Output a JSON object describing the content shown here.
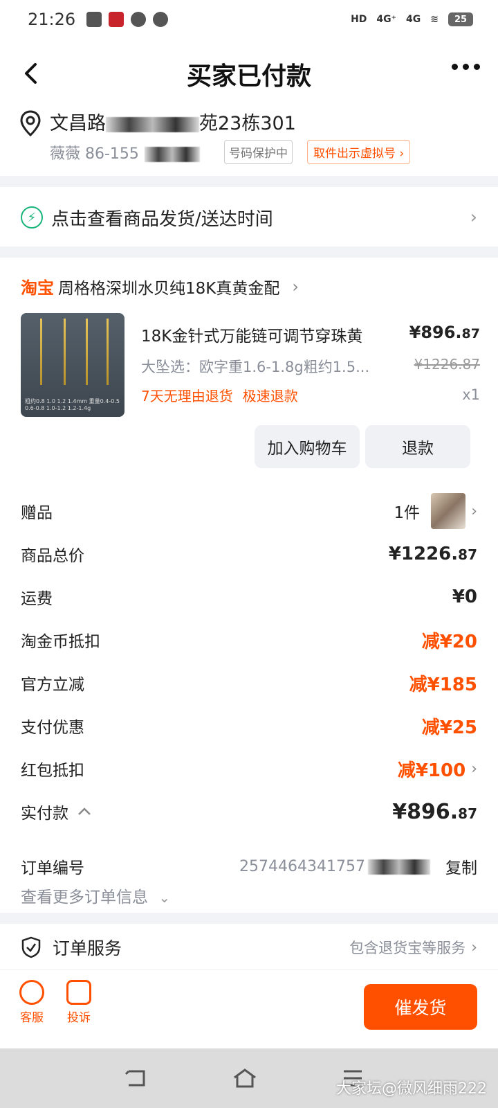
{
  "status": {
    "time": "21:26",
    "battery": "25",
    "network1": "4G⁺",
    "network2": "4G"
  },
  "nav": {
    "title": "买家已付款"
  },
  "address": {
    "line_prefix": "文昌路",
    "line_suffix": "苑23栋301",
    "contact": "薇薇 86-155",
    "protect_tag": "号码保护中",
    "virtual_tag": "取件出示虚拟号 ›"
  },
  "delivery": {
    "text": "点击查看商品发货/送达时间"
  },
  "shop": {
    "logo": "淘宝",
    "name": "周格格深圳水贝纯18K真黄金配"
  },
  "product": {
    "title": "18K金针式万能链可调节穿珠黄",
    "price_main": "¥896.",
    "price_cents": "87",
    "spec": "大坠选：欧字重1.6-1.8g粗约1.5...",
    "original_price": "¥1226.87",
    "promo1": "7天无理由退货",
    "promo2": "极速退款",
    "qty": "x1",
    "img_caption": "粗约0.8 1.0 1.2 1.4mm 重量0.4-0.5 0.6-0.8 1.0-1.2 1.2-1.4g"
  },
  "buttons": {
    "cart": "加入购物车",
    "refund": "退款"
  },
  "fees": {
    "gift_label": "赠品",
    "gift_count": "1件",
    "total_label": "商品总价",
    "total_main": "¥1226.",
    "total_cents": "87",
    "shipping_label": "运费",
    "shipping": "¥0",
    "coin_label": "淘金币抵扣",
    "coin": "减¥20",
    "official_label": "官方立减",
    "official": "减¥185",
    "pay_label": "支付优惠",
    "pay": "减¥25",
    "redpack_label": "红包抵扣",
    "redpack": "减¥100",
    "paid_label": "实付款",
    "paid_main": "¥896.",
    "paid_cents": "87"
  },
  "order": {
    "label": "订单编号",
    "number": "2574464341757",
    "copy": "复制",
    "more": "查看更多订单信息"
  },
  "service": {
    "title": "订单服务",
    "desc": "包含退货宝等服务"
  },
  "bottom": {
    "support": "客服",
    "complain": "投诉",
    "urge": "催发货"
  },
  "watermark": "大家坛@微风细雨222",
  "colors": {
    "accent": "#ff5000",
    "green": "#19b47a"
  }
}
